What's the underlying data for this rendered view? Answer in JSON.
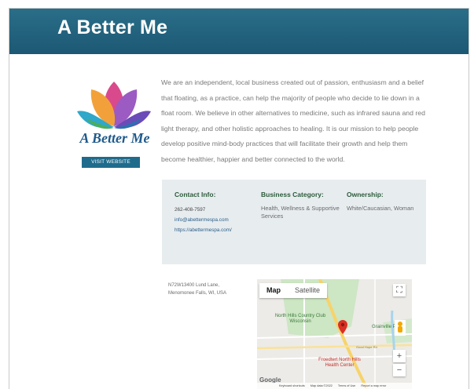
{
  "header": {
    "title": "A Better Me"
  },
  "logo": {
    "text": "A Better Me"
  },
  "visit_button": "VISIT WEBSITE",
  "description": "We are an independent, local business created out of passion, enthusiasm and a belief that floating, as a practice, can help the majority of people who decide to lie down in a float room. We believe in other alternatives to medicine, such as infrared sauna and red light therapy, and other holistic approaches to healing. It is our mission to help people develop positive mind-body practices that will facilitate their growth and help them become healthier, happier and better connected to the world.",
  "contact": {
    "heading": "Contact Info:",
    "phone": "262-408-7597",
    "email": "info@abettermespa.com",
    "website": "https://abettermespa.com/"
  },
  "category": {
    "heading": "Business Category:",
    "value": "Health, Wellness & Supportive Services"
  },
  "ownership": {
    "heading": "Ownership:",
    "value": "White/Caucasian, Woman"
  },
  "address": "N72W13400 Lund Lane, Menomonee Falls, WI, USA",
  "map": {
    "tabs": [
      "Map",
      "Satellite"
    ],
    "labels": {
      "club": "North Hills Country Club Wisconsin",
      "hospital": "Froedtert North Hills Health Center",
      "park": "Grainville Par",
      "road": "Good Hope Rd"
    },
    "google": "Google",
    "attribution": [
      "Keyboard shortcuts",
      "Map data ©2022",
      "Terms of Use",
      "Report a map error"
    ],
    "zoom_in": "+",
    "zoom_out": "−",
    "fullscreen": "⛶"
  },
  "colors": {
    "header": "#1f5f7c",
    "button": "#1f6b8c",
    "info_bg": "#e7ecef",
    "heading_green": "#2b5b3a",
    "pin": "#d93025"
  }
}
